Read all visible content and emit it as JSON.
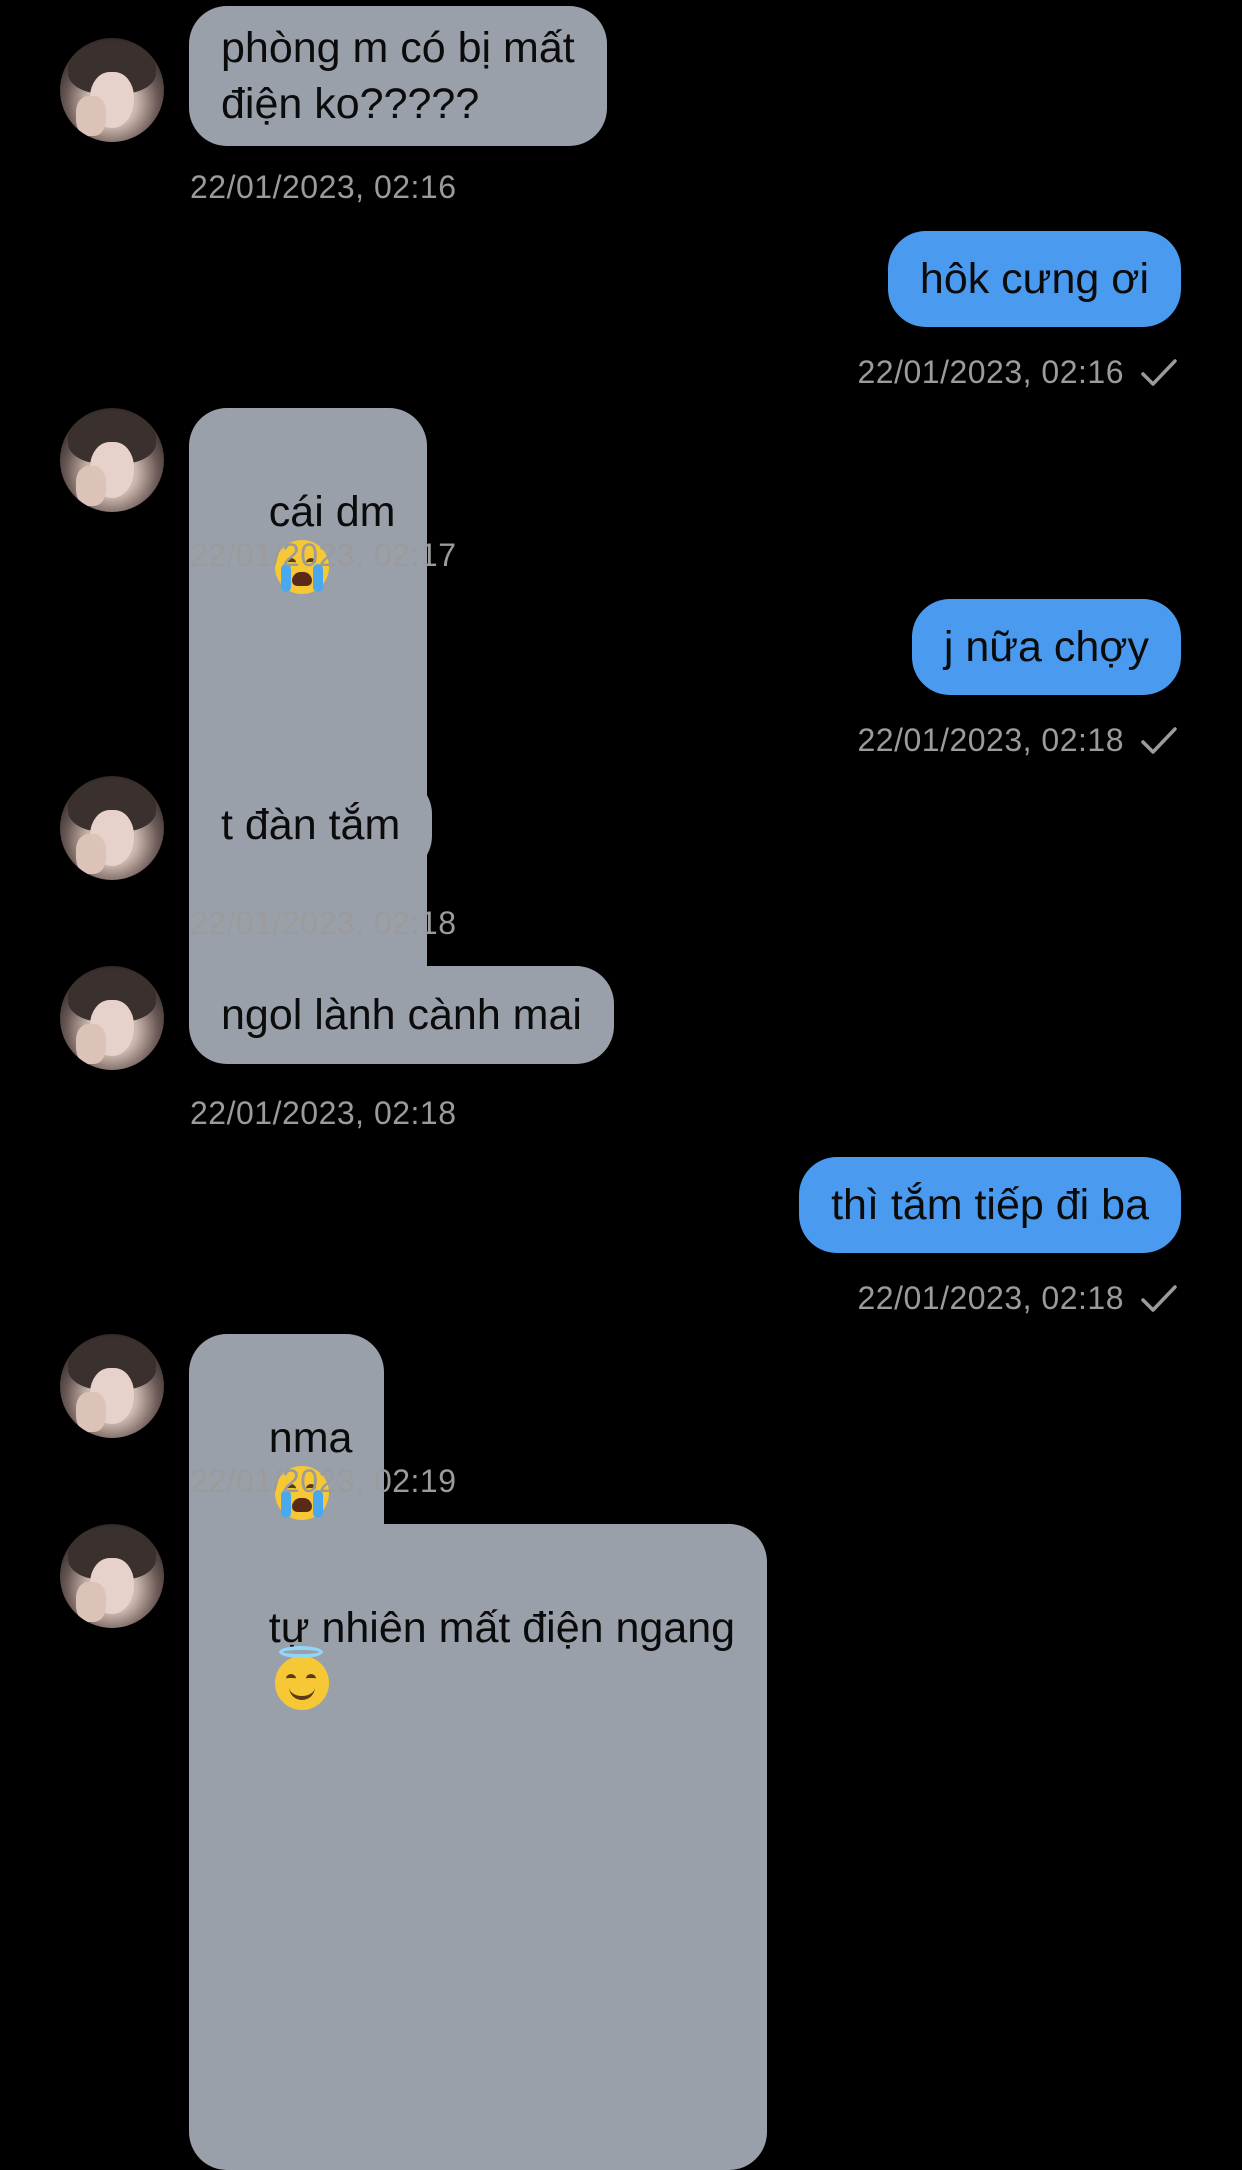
{
  "colors": {
    "background": "#000000",
    "incoming_bubble": "#9aa0aa",
    "outgoing_bubble": "#4a9bf0",
    "timestamp": "#9b9b9b"
  },
  "messages": [
    {
      "direction": "in",
      "text": "phòng m có bị mất\nđiện ko?????",
      "time": "22/01/2023, 02:16"
    },
    {
      "direction": "out",
      "text": "hôk cưng ơi",
      "time": "22/01/2023, 02:16",
      "status_icon": "checkmark-icon"
    },
    {
      "direction": "in",
      "text": "cái dm",
      "emoji": "loudly-crying-face",
      "time": "22/01/2023, 02:17"
    },
    {
      "direction": "out",
      "text": "j nữa chợy",
      "time": "22/01/2023, 02:18",
      "status_icon": "checkmark-icon"
    },
    {
      "direction": "in",
      "text": "t đàn tắm",
      "time": "22/01/2023, 02:18"
    },
    {
      "direction": "in",
      "text": "ngol lành cành mai",
      "time": "22/01/2023, 02:18"
    },
    {
      "direction": "out",
      "text": "thì tắm tiếp đi ba",
      "time": "22/01/2023, 02:18",
      "status_icon": "checkmark-icon"
    },
    {
      "direction": "in",
      "text": "nma",
      "emoji": "loudly-crying-face",
      "time": "22/01/2023, 02:19"
    },
    {
      "direction": "in",
      "text": "tự nhiên mất điện ngang",
      "emoji": "smiling-face-with-halo"
    }
  ]
}
